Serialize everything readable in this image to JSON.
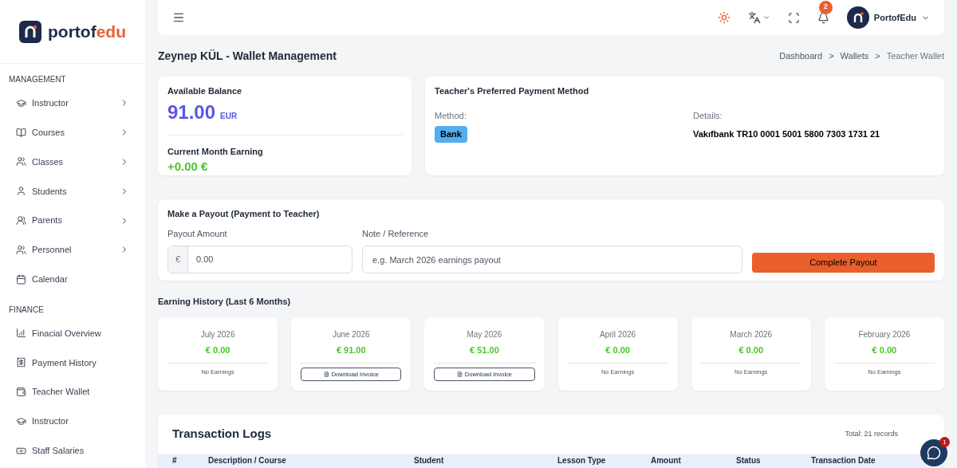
{
  "brand": {
    "name_dark": "portof",
    "name_accent": "edu"
  },
  "sidebar": {
    "sections": [
      {
        "title": "MANAGEMENT",
        "items": [
          {
            "label": "Instructor",
            "expandable": true
          },
          {
            "label": "Courses",
            "expandable": true
          },
          {
            "label": "Classes",
            "expandable": true
          },
          {
            "label": "Students",
            "expandable": true
          },
          {
            "label": "Parents",
            "expandable": true
          },
          {
            "label": "Personnel",
            "expandable": true
          },
          {
            "label": "Calendar",
            "expandable": false
          }
        ]
      },
      {
        "title": "FINANCE",
        "items": [
          {
            "label": "Finacial Overview",
            "expandable": false
          },
          {
            "label": "Payment History",
            "expandable": false
          },
          {
            "label": "Teacher Wallet",
            "expandable": false
          },
          {
            "label": "Instructor",
            "expandable": false
          },
          {
            "label": "Staff Salaries",
            "expandable": false
          }
        ]
      }
    ]
  },
  "topbar": {
    "notification_count": "2",
    "user": "PortofEdu"
  },
  "page": {
    "title": "Zeynep KÜL - Wallet Management",
    "breadcrumb": [
      "Dashboard",
      "Wallets",
      "Teacher Wallet"
    ],
    "separator": ">"
  },
  "balance": {
    "label": "Available Balance",
    "amount": "91.00",
    "currency": "EUR",
    "month_label": "Current Month Earning",
    "month_value": "+0.00 €"
  },
  "payment_method": {
    "title": "Teacher's Preferred Payment Method",
    "method_label": "Method:",
    "method": "Bank",
    "details_label": "Details:",
    "details": "Vakıfbank TR10 0001 5001 5800 7303 1731 21"
  },
  "payout": {
    "title": "Make a Payout (Payment to Teacher)",
    "amount_label": "Payout Amount",
    "currency_symbol": "€",
    "amount_placeholder": "0.00",
    "note_label": "Note / Reference",
    "note_placeholder": "e.g. March 2026 earnings payout",
    "button": "Complete Payout"
  },
  "earning_history": {
    "title": "Earning History (Last 6 Months)",
    "months": [
      {
        "month": "July 2026",
        "amount": "€ 0.00",
        "kind": "empty",
        "action": "No Earnings"
      },
      {
        "month": "June 2026",
        "amount": "€ 91.00",
        "kind": "invoice",
        "action": "Download Invoice"
      },
      {
        "month": "May 2026",
        "amount": "€ 51.00",
        "kind": "invoice",
        "action": "Download Invoice"
      },
      {
        "month": "April 2026",
        "amount": "€ 0.00",
        "kind": "empty",
        "action": "No Earnings"
      },
      {
        "month": "March 2026",
        "amount": "€ 0.00",
        "kind": "empty",
        "action": "No Earnings"
      },
      {
        "month": "February 2026",
        "amount": "€ 0.00",
        "kind": "empty",
        "action": "No Earnings"
      }
    ]
  },
  "transactions": {
    "title": "Transaction Logs",
    "total": "Total: 21 records",
    "columns": [
      "#",
      "Description / Course",
      "Student",
      "Lesson Type",
      "Amount",
      "Status",
      "Transaction Date"
    ]
  },
  "chat": {
    "unread": "1"
  }
}
